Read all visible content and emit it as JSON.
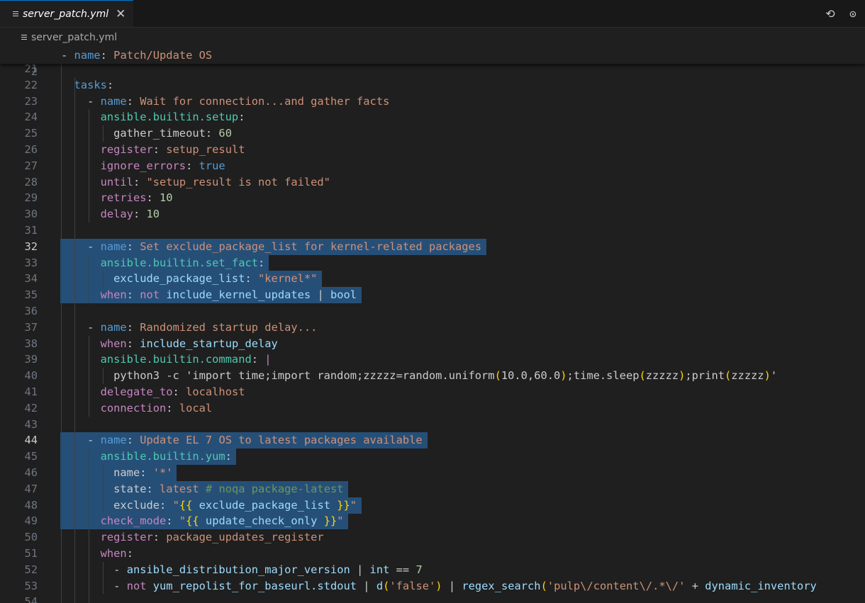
{
  "tab": {
    "title": "server_patch.yml",
    "close": "✕"
  },
  "toolbar": {
    "open_changes": "⟲",
    "timeline": "⊙"
  },
  "breadcrumb": {
    "file": "server_patch.yml"
  },
  "sticky": {
    "num": "2",
    "dash": "- ",
    "key": "name",
    "sep": ": ",
    "val": "Patch/Update OS"
  },
  "lines": [
    {
      "n": "21",
      "parts": []
    },
    {
      "n": "22",
      "parts": [
        [
          "",
          "  "
        ],
        [
          "k",
          "tasks"
        ],
        [
          "w",
          ":"
        ]
      ]
    },
    {
      "n": "23",
      "parts": [
        [
          "",
          "    "
        ],
        [
          "w",
          "- "
        ],
        [
          "k",
          "name"
        ],
        [
          "w",
          ": "
        ],
        [
          "s",
          "Wait for connection...and gather facts"
        ]
      ]
    },
    {
      "n": "24",
      "parts": [
        [
          "",
          "      "
        ],
        [
          "g",
          "ansible.builtin.setup"
        ],
        [
          "w",
          ":"
        ]
      ]
    },
    {
      "n": "25",
      "parts": [
        [
          "",
          "        "
        ],
        [
          "w",
          "gather_timeout"
        ],
        [
          "w",
          ": "
        ],
        [
          "num",
          "60"
        ]
      ]
    },
    {
      "n": "26",
      "parts": [
        [
          "",
          "      "
        ],
        [
          "t",
          "register"
        ],
        [
          "w",
          ": "
        ],
        [
          "s",
          "setup_result"
        ]
      ]
    },
    {
      "n": "27",
      "parts": [
        [
          "",
          "      "
        ],
        [
          "t",
          "ignore_errors"
        ],
        [
          "w",
          ": "
        ],
        [
          "k",
          "true"
        ]
      ]
    },
    {
      "n": "28",
      "parts": [
        [
          "",
          "      "
        ],
        [
          "t",
          "until"
        ],
        [
          "w",
          ": "
        ],
        [
          "s",
          "\"setup_result is not failed\""
        ]
      ]
    },
    {
      "n": "29",
      "parts": [
        [
          "",
          "      "
        ],
        [
          "t",
          "retries"
        ],
        [
          "w",
          ": "
        ],
        [
          "num",
          "10"
        ]
      ]
    },
    {
      "n": "30",
      "parts": [
        [
          "",
          "      "
        ],
        [
          "t",
          "delay"
        ],
        [
          "w",
          ": "
        ],
        [
          "num",
          "10"
        ]
      ]
    },
    {
      "n": "31",
      "parts": []
    },
    {
      "n": "32",
      "parts": [
        [
          "",
          "    "
        ],
        [
          "w",
          "- "
        ],
        [
          "k",
          "name"
        ],
        [
          "w",
          ": "
        ],
        [
          "s",
          "Set exclude_package_list for kernel-related packages"
        ]
      ]
    },
    {
      "n": "33",
      "parts": [
        [
          "",
          "      "
        ],
        [
          "g",
          "ansible.builtin.set_fact"
        ],
        [
          "w",
          ":"
        ]
      ]
    },
    {
      "n": "34",
      "parts": [
        [
          "",
          "        "
        ],
        [
          "lb",
          "exclude_package_list"
        ],
        [
          "w",
          ": "
        ],
        [
          "s",
          "\"kernel*\""
        ]
      ]
    },
    {
      "n": "35",
      "parts": [
        [
          "",
          "      "
        ],
        [
          "t",
          "when"
        ],
        [
          "w",
          ": "
        ],
        [
          "t",
          "not "
        ],
        [
          "lb",
          "include_kernel_updates"
        ],
        [
          "w",
          " | "
        ],
        [
          "lb",
          "bool"
        ]
      ]
    },
    {
      "n": "36",
      "parts": []
    },
    {
      "n": "37",
      "parts": [
        [
          "",
          "    "
        ],
        [
          "w",
          "- "
        ],
        [
          "k",
          "name"
        ],
        [
          "w",
          ": "
        ],
        [
          "s",
          "Randomized startup delay..."
        ]
      ]
    },
    {
      "n": "38",
      "parts": [
        [
          "",
          "      "
        ],
        [
          "t",
          "when"
        ],
        [
          "w",
          ": "
        ],
        [
          "lb",
          "include_startup_delay"
        ]
      ]
    },
    {
      "n": "39",
      "parts": [
        [
          "",
          "      "
        ],
        [
          "g",
          "ansible.builtin.command"
        ],
        [
          "w",
          ": "
        ],
        [
          "t",
          "|"
        ]
      ]
    },
    {
      "n": "40",
      "parts": [
        [
          "",
          "        "
        ],
        [
          "w",
          "python3 -c 'import time;import random;zzzzz=random.uniform"
        ],
        [
          "y",
          "("
        ],
        [
          "w",
          "10.0,60.0"
        ],
        [
          "y",
          ")"
        ],
        [
          "w",
          ";time.sleep"
        ],
        [
          "y",
          "("
        ],
        [
          "w",
          "zzzzz"
        ],
        [
          "y",
          ")"
        ],
        [
          "w",
          ";print"
        ],
        [
          "y",
          "("
        ],
        [
          "w",
          "zzzzz"
        ],
        [
          "y",
          ")"
        ],
        [
          "w",
          "'"
        ]
      ]
    },
    {
      "n": "41",
      "parts": [
        [
          "",
          "      "
        ],
        [
          "t",
          "delegate_to"
        ],
        [
          "w",
          ": "
        ],
        [
          "s",
          "localhost"
        ]
      ]
    },
    {
      "n": "42",
      "parts": [
        [
          "",
          "      "
        ],
        [
          "t",
          "connection"
        ],
        [
          "w",
          ": "
        ],
        [
          "s",
          "local"
        ]
      ]
    },
    {
      "n": "43",
      "parts": []
    },
    {
      "n": "44",
      "parts": [
        [
          "",
          "    "
        ],
        [
          "w",
          "- "
        ],
        [
          "k",
          "name"
        ],
        [
          "w",
          ": "
        ],
        [
          "s",
          "Update EL 7 OS to latest packages available"
        ]
      ]
    },
    {
      "n": "45",
      "parts": [
        [
          "",
          "      "
        ],
        [
          "g",
          "ansible.builtin.yum"
        ],
        [
          "w",
          ":"
        ]
      ]
    },
    {
      "n": "46",
      "parts": [
        [
          "",
          "        "
        ],
        [
          "w",
          "name"
        ],
        [
          "w",
          ": "
        ],
        [
          "s",
          "'*'"
        ]
      ]
    },
    {
      "n": "47",
      "parts": [
        [
          "",
          "        "
        ],
        [
          "w",
          "state"
        ],
        [
          "w",
          ": "
        ],
        [
          "s",
          "latest "
        ],
        [
          "c",
          "# noqa package-latest"
        ]
      ]
    },
    {
      "n": "48",
      "parts": [
        [
          "",
          "        "
        ],
        [
          "w",
          "exclude"
        ],
        [
          "w",
          ": "
        ],
        [
          "s",
          "\""
        ],
        [
          "y",
          "{{"
        ],
        [
          "lb",
          " exclude_package_list "
        ],
        [
          "y",
          "}}"
        ],
        [
          "s",
          "\""
        ]
      ]
    },
    {
      "n": "49",
      "parts": [
        [
          "",
          "      "
        ],
        [
          "t",
          "check_mode"
        ],
        [
          "w",
          ": "
        ],
        [
          "s",
          "\""
        ],
        [
          "y",
          "{{"
        ],
        [
          "lb",
          " update_check_only "
        ],
        [
          "y",
          "}}"
        ],
        [
          "s",
          "\""
        ]
      ]
    },
    {
      "n": "50",
      "parts": [
        [
          "",
          "      "
        ],
        [
          "t",
          "register"
        ],
        [
          "w",
          ": "
        ],
        [
          "s",
          "package_updates_register"
        ]
      ]
    },
    {
      "n": "51",
      "parts": [
        [
          "",
          "      "
        ],
        [
          "t",
          "when"
        ],
        [
          "w",
          ":"
        ]
      ]
    },
    {
      "n": "52",
      "parts": [
        [
          "",
          "        "
        ],
        [
          "w",
          "- "
        ],
        [
          "lb",
          "ansible_distribution_major_version"
        ],
        [
          "w",
          " | "
        ],
        [
          "lb",
          "int"
        ],
        [
          "w",
          " == "
        ],
        [
          "num",
          "7"
        ]
      ]
    },
    {
      "n": "53",
      "parts": [
        [
          "",
          "        "
        ],
        [
          "w",
          "- "
        ],
        [
          "t",
          "not "
        ],
        [
          "lb",
          "yum_repolist_for_baseurl.stdout"
        ],
        [
          "w",
          " | "
        ],
        [
          "lb",
          "d"
        ],
        [
          "y",
          "("
        ],
        [
          "s",
          "'false'"
        ],
        [
          "y",
          ")"
        ],
        [
          "w",
          " | "
        ],
        [
          "lb",
          "regex_search"
        ],
        [
          "y",
          "("
        ],
        [
          "s",
          "'pulp\\/content\\/.*\\/'"
        ],
        [
          "w",
          " + "
        ],
        [
          "lb",
          "dynamic_inventory"
        ]
      ]
    },
    {
      "n": "54",
      "parts": []
    }
  ],
  "active_lines": [
    "32",
    "44"
  ],
  "colors": {
    "background": "#1f1f1f",
    "selection": "#264f78",
    "accent": "#0078d4"
  }
}
